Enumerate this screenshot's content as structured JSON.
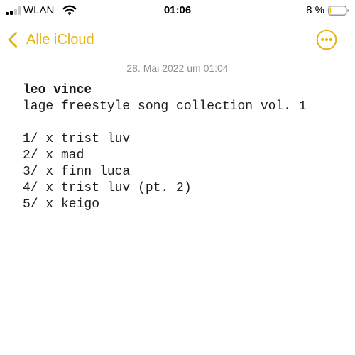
{
  "status_bar": {
    "carrier": "WLAN",
    "time": "01:06",
    "battery_percent": "8 %",
    "battery_level": 0.08,
    "signal_bars": 2
  },
  "nav": {
    "back_label": "Alle iCloud",
    "accent_color": "#e6b40f"
  },
  "note": {
    "date": "28. Mai 2022 um 01:04",
    "title": "leo vince",
    "subtitle": "lage freestyle song collection vol. 1",
    "tracks": [
      "1/ x trist luv",
      "2/ x mad",
      "3/ x finn luca",
      "4/ x trist luv (pt. 2)",
      "5/ x keigo"
    ]
  }
}
